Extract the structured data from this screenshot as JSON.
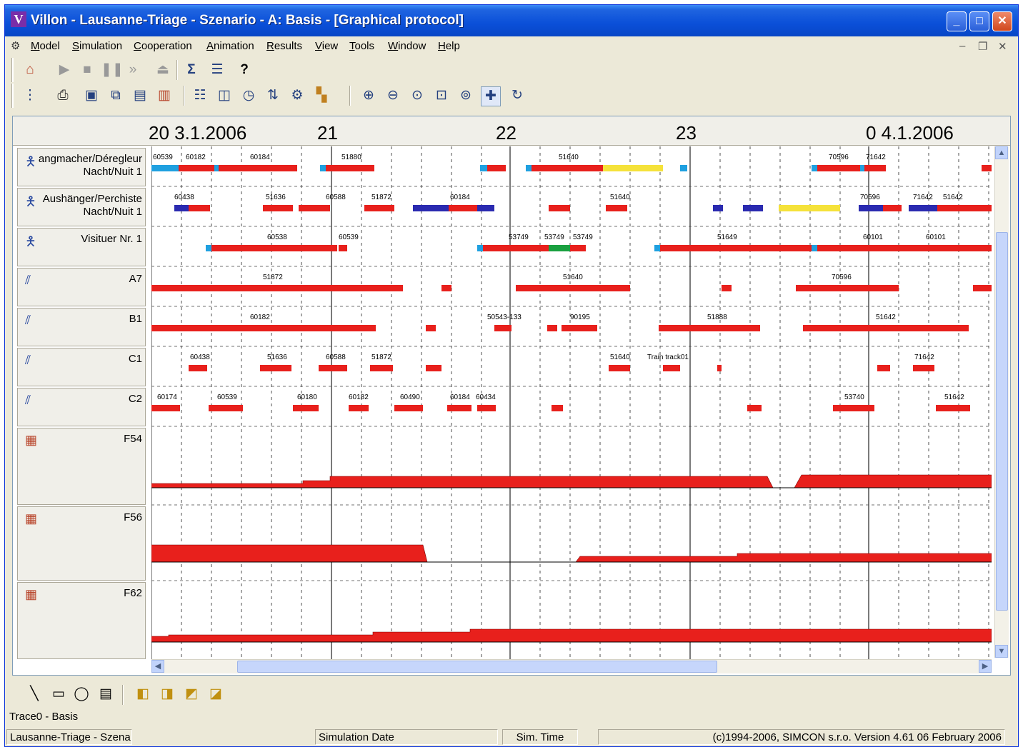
{
  "window": {
    "title": "Villon - Lausanne-Triage - Szenario - A: Basis - [Graphical protocol]",
    "app_icon": "V"
  },
  "menu": [
    "Model",
    "Simulation",
    "Cooperation",
    "Animation",
    "Results",
    "View",
    "Tools",
    "Window",
    "Help"
  ],
  "toolbar1": [
    "home-icon",
    "play-icon",
    "stop-icon",
    "pause-icon",
    "step-icon",
    "eject-icon",
    "sum-icon",
    "list-icon",
    "help-pointer-icon"
  ],
  "toolbar2": [
    "tree-icon",
    "print-icon",
    "monitor-icon",
    "copy-icon",
    "paste-icon",
    "paste-special-icon",
    "report-icon",
    "preview-icon",
    "clock-icon",
    "sort-icon",
    "properties-icon",
    "palette-icon",
    "zoom-in-icon",
    "zoom-out-icon",
    "zoom-icon",
    "zoom-fit-icon",
    "zoom-select-icon",
    "pan-icon",
    "refresh-icon"
  ],
  "icons": {
    "sum": "Σ",
    "help": "?",
    "pan": "✚",
    "refresh": "↻"
  },
  "axis_labels": [
    {
      "text": "20 3.1.2006",
      "hour": 20
    },
    {
      "text": "21",
      "hour": 21
    },
    {
      "text": "22",
      "hour": 22
    },
    {
      "text": "23",
      "hour": 23
    },
    {
      "text": "0 4.1.2006",
      "hour": 24
    }
  ],
  "rows": [
    {
      "line1": "angmacher/Déregleur",
      "line2": "Nacht/Nuit 1",
      "icon": "person-icon",
      "kind": "staff"
    },
    {
      "line1": "Aushänger/Perchiste",
      "line2": "Nacht/Nuit 1",
      "icon": "person-icon",
      "kind": "staff"
    },
    {
      "line1": "Visituer Nr. 1",
      "line2": "",
      "icon": "person-icon",
      "kind": "staff"
    },
    {
      "line1": "A7",
      "line2": "",
      "icon": "track-icon",
      "kind": "track"
    },
    {
      "line1": "B1",
      "line2": "",
      "icon": "track-icon",
      "kind": "track"
    },
    {
      "line1": "C1",
      "line2": "",
      "icon": "track-icon",
      "kind": "track"
    },
    {
      "line1": "C2",
      "line2": "",
      "icon": "track-icon",
      "kind": "track"
    },
    {
      "line1": "F54",
      "line2": "",
      "icon": "yard-icon",
      "kind": "yard"
    },
    {
      "line1": "F56",
      "line2": "",
      "icon": "yard-icon",
      "kind": "yard"
    },
    {
      "line1": "F62",
      "line2": "",
      "icon": "yard-icon",
      "kind": "yard"
    }
  ],
  "bar_labels": [
    [
      "60539",
      "60182",
      "60184",
      "51880",
      "51640",
      "70596",
      "71642"
    ],
    [
      "60438",
      "51636",
      "60588",
      "51872",
      "60184",
      "51640",
      "70596",
      "71642",
      "51642"
    ],
    [
      "60538",
      "60539",
      "53749",
      "53749",
      "53749",
      "51649",
      "60101",
      "60101"
    ],
    [
      "51872",
      "51640",
      "70596"
    ],
    [
      "60182",
      "50543-133",
      "90195",
      "51888",
      "51642"
    ],
    [
      "60438",
      "51636",
      "60588",
      "51872",
      "51640",
      "Train track01",
      "71642"
    ],
    [
      "60174",
      "60539",
      "60180",
      "60182",
      "60490",
      "60184",
      "60434",
      "53740",
      "51642"
    ]
  ],
  "colors": {
    "occupied": "#e8201c",
    "waiting": "#f5e23a",
    "start": "#1fa0e0",
    "transfer": "#2a2ab0",
    "ok": "#1aa040"
  },
  "statusline": "Trace0 - Basis",
  "statusbar": {
    "model": "Lausanne-Triage - Szena",
    "date_label": "Simulation Date",
    "time_label": "Sim. Time",
    "copyright": "(c)1994-2006, SIMCON s.r.o.  Version 4.61   06 February 2006"
  }
}
